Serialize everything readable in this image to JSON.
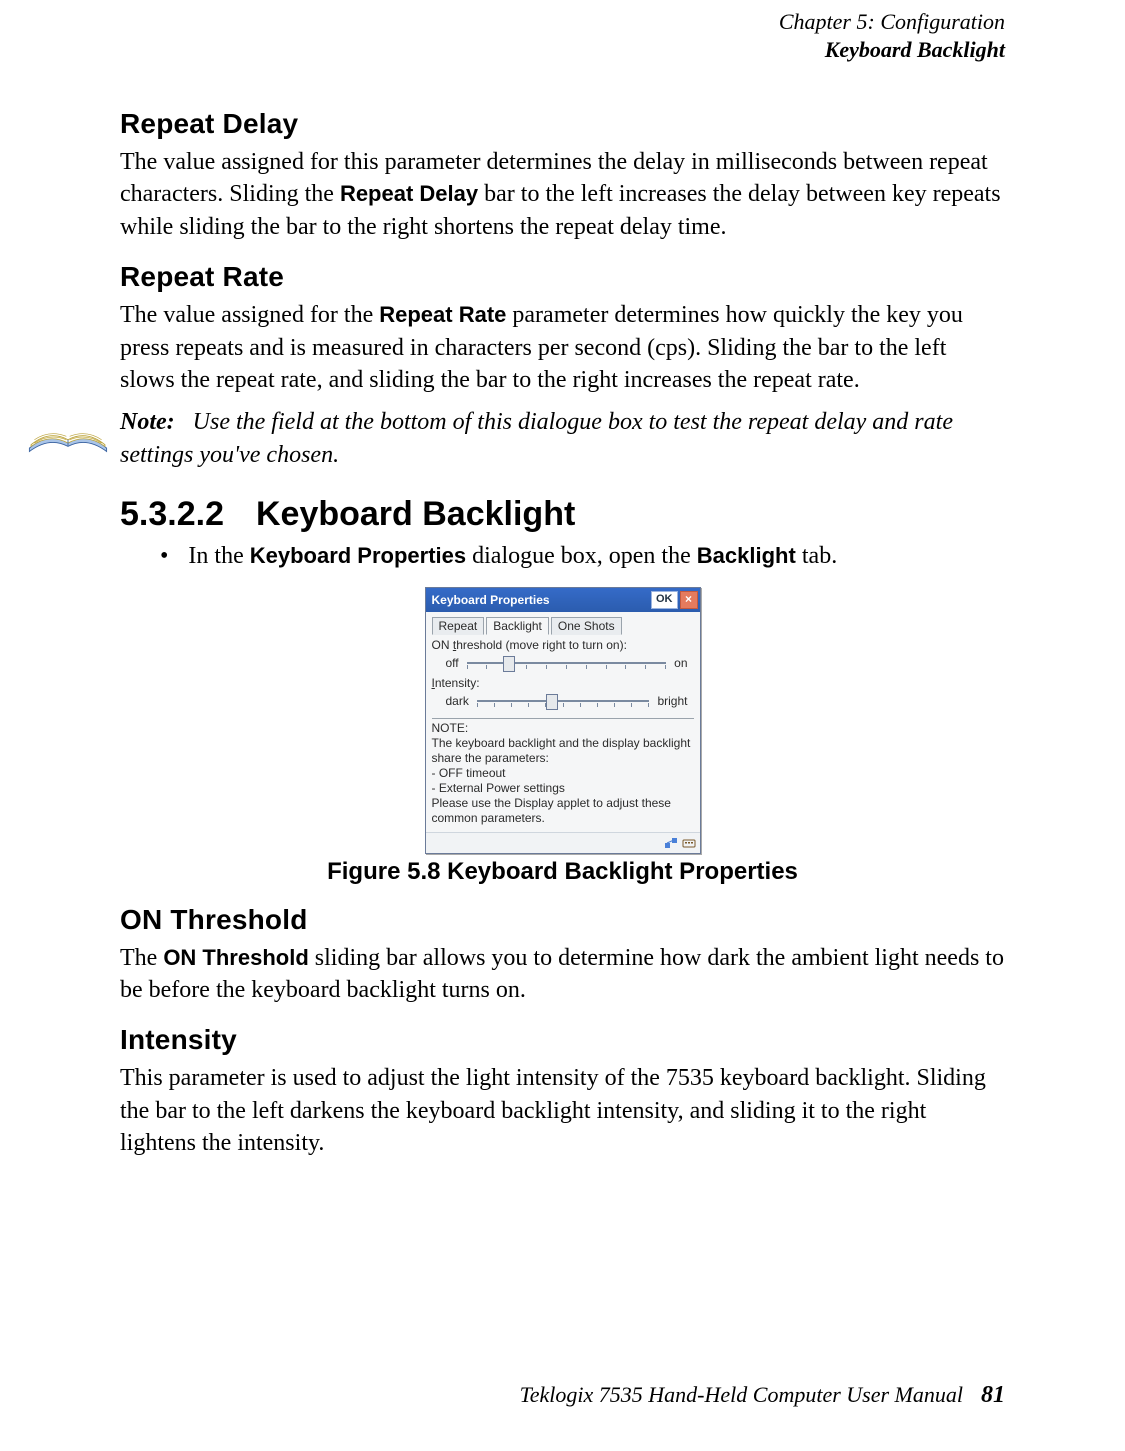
{
  "header": {
    "line1": "Chapter  5:  Configuration",
    "line2": "Keyboard Backlight"
  },
  "repeat_delay": {
    "title": "Repeat  Delay",
    "p_pre": "The value assigned for this parameter determines the delay in milliseconds between repeat characters. Sliding the ",
    "term": "Repeat  Delay",
    "p_post": " bar to the left increases the delay between key repeats while sliding the bar to the right shortens the repeat delay time."
  },
  "repeat_rate": {
    "title": "Repeat  Rate",
    "p_pre": "The value assigned for the ",
    "term": "Repeat  Rate",
    "p_post": " parameter determines how quickly the key you press repeats and is measured in characters per second (cps). Sliding the bar to the left slows the repeat rate, and sliding the bar to the right increases the repeat rate."
  },
  "note": {
    "label": "Note:",
    "text": "Use the field at the bottom of this dialogue box to test the repeat delay and rate settings you've chosen."
  },
  "section": {
    "number": "5.3.2.2",
    "title": "Keyboard  Backlight"
  },
  "bullet": {
    "pre": "In the ",
    "term1": "Keyboard  Properties",
    "mid": " dialogue box, open the ",
    "term2": "Backlight ",
    "post": "tab."
  },
  "dialog": {
    "title": "Keyboard Properties",
    "ok": "OK",
    "tabs": {
      "repeat": "Repeat",
      "backlight": "Backlight",
      "one_shots": "One Shots"
    },
    "threshold_label_pre": "ON ",
    "threshold_label_ul": "t",
    "threshold_label_post": "hreshold (move right to turn on):",
    "threshold_left": "off",
    "threshold_right": "on",
    "intensity_label_ul": "I",
    "intensity_label_post": "ntensity:",
    "intensity_left": "dark",
    "intensity_right": "bright",
    "note_heading": "NOTE:",
    "note_body": "The keyboard backlight and the display backlight share the parameters:\n - OFF timeout\n - External Power settings\nPlease use the Display applet to adjust these common parameters."
  },
  "figure_caption": "Figure  5.8  Keyboard  Backlight  Properties",
  "on_threshold": {
    "title": "ON  Threshold",
    "p_pre": "The ",
    "term": "ON  Threshold",
    "p_post": " sliding bar allows you to determine how dark the ambient light needs to be before the keyboard backlight turns on."
  },
  "intensity": {
    "title": "Intensity",
    "p": "This parameter is used to adjust the light intensity of the 7535 keyboard backlight. Sliding the bar to the left darkens the keyboard backlight intensity, and sliding it to the right lightens the intensity."
  },
  "footer": {
    "text": "Teklogix 7535 Hand-Held Computer User Manual",
    "page": "81"
  }
}
